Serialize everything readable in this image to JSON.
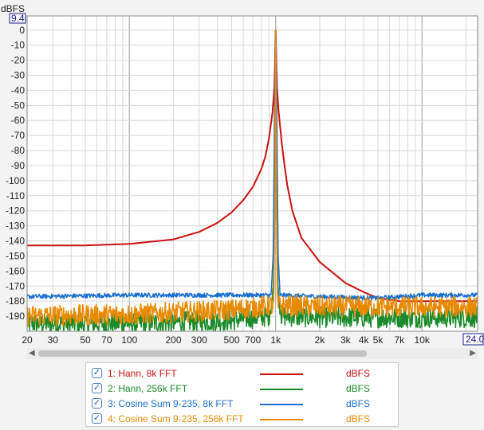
{
  "chart_data": {
    "type": "line",
    "title": "",
    "ylabel": "dBFS",
    "xlabel": "",
    "x_scale": "log",
    "xlim": [
      20,
      24000
    ],
    "ylim": [
      -200,
      9.4
    ],
    "y_top_label": "9.4",
    "x_right_label": "24.0",
    "y_ticks": [
      "0",
      "-10",
      "-20",
      "-30",
      "-40",
      "-50",
      "-60",
      "-70",
      "-80",
      "-90",
      "-100",
      "-110",
      "-120",
      "-130",
      "-140",
      "-150",
      "-160",
      "-170",
      "-180",
      "-190"
    ],
    "y_tick_values": [
      0,
      -10,
      -20,
      -30,
      -40,
      -50,
      -60,
      -70,
      -80,
      -90,
      -100,
      -110,
      -120,
      -130,
      -140,
      -150,
      -160,
      -170,
      -180,
      -190
    ],
    "x_ticks": [
      "20",
      "30",
      "50",
      "70",
      "100",
      "200",
      "300",
      "500",
      "700",
      "1k",
      "2k",
      "3k",
      "4k",
      "5k",
      "7k",
      "10k"
    ],
    "x_tick_values": [
      20,
      30,
      50,
      70,
      100,
      200,
      300,
      500,
      700,
      1000,
      2000,
      3000,
      4000,
      5000,
      7000,
      10000
    ],
    "grid": true,
    "legend_position": "bottom",
    "series": [
      {
        "name": "1: Hann, 8k FFT",
        "unit": "dBFS",
        "color": "#cc1010",
        "checked": true,
        "x": [
          20,
          50,
          100,
          200,
          300,
          400,
          500,
          600,
          700,
          800,
          850,
          900,
          950,
          980,
          1000,
          1020,
          1050,
          1100,
          1150,
          1200,
          1300,
          1500,
          2000,
          3000,
          4000,
          5000,
          7000,
          10000,
          15000,
          24000
        ],
        "y": [
          -143,
          -143,
          -142,
          -139,
          -134,
          -128,
          -121,
          -113,
          -104,
          -92,
          -84,
          -72,
          -55,
          -38,
          0,
          -38,
          -55,
          -75,
          -90,
          -103,
          -120,
          -138,
          -154,
          -168,
          -174,
          -178,
          -180,
          -180,
          -180,
          -180
        ]
      },
      {
        "name": "2: Hann, 256k FFT",
        "unit": "dBFS",
        "color": "#1a8a2a",
        "checked": true,
        "x": [
          20,
          100,
          500,
          900,
          960,
          985,
          995,
          1000,
          1005,
          1015,
          1040,
          1100,
          2000,
          10000,
          24000
        ],
        "y": [
          -195,
          -195,
          -193,
          -190,
          -175,
          -120,
          -30,
          0,
          -30,
          -120,
          -175,
          -190,
          -191,
          -191,
          -191
        ],
        "noise": true
      },
      {
        "name": "3: Cosine Sum 9-235, 8k FFT",
        "unit": "dBFS",
        "color": "#1a6fd0",
        "checked": true,
        "x": [
          20,
          100,
          500,
          930,
          960,
          975,
          985,
          995,
          1000,
          1005,
          1015,
          1025,
          1040,
          1070,
          2000,
          5000,
          10000,
          24000
        ],
        "y": [
          -177,
          -176,
          -176,
          -176,
          -150,
          -90,
          -40,
          -10,
          0,
          -10,
          -40,
          -90,
          -150,
          -176,
          -177,
          -178,
          -176,
          -176
        ],
        "noise": true
      },
      {
        "name": "4: Cosine Sum 9-235, 256k FFT",
        "unit": "dBFS",
        "color": "#e88a00",
        "checked": true,
        "x": [
          20,
          100,
          500,
          970,
          990,
          996,
          1000,
          1004,
          1010,
          1030,
          2000,
          10000,
          24000
        ],
        "y": [
          -190,
          -189,
          -186,
          -183,
          -100,
          -20,
          0,
          -20,
          -100,
          -183,
          -184,
          -184,
          -184
        ],
        "noise": true
      }
    ]
  }
}
